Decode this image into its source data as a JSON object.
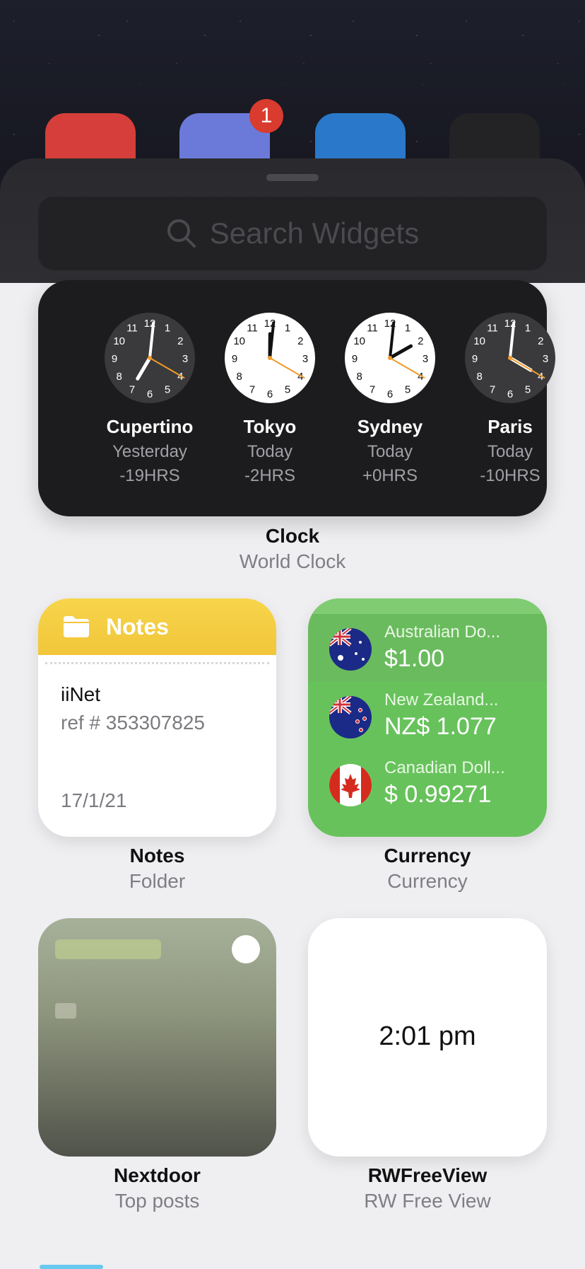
{
  "home": {
    "badge_count": "1"
  },
  "search": {
    "placeholder": "Search Widgets"
  },
  "clock_widget": {
    "cities": [
      {
        "name": "Cupertino",
        "day": "Yesterday",
        "offset": "-19HRS",
        "face": "dark",
        "hour": 7.0,
        "minute": 1
      },
      {
        "name": "Tokyo",
        "day": "Today",
        "offset": "-2HRS",
        "face": "light",
        "hour": 12.0,
        "minute": 1
      },
      {
        "name": "Sydney",
        "day": "Today",
        "offset": "+0HRS",
        "face": "light",
        "hour": 2.0,
        "minute": 1
      },
      {
        "name": "Paris",
        "day": "Today",
        "offset": "-10HRS",
        "face": "dark",
        "hour": 4.0,
        "minute": 1
      }
    ],
    "title": "Clock",
    "subtitle": "World Clock"
  },
  "notes_widget": {
    "header": "Notes",
    "note_title": "iiNet",
    "note_body": "ref # 353307825",
    "date": "17/1/21",
    "title": "Notes",
    "subtitle": "Folder"
  },
  "currency_widget": {
    "rows": [
      {
        "name": "Australian Do...",
        "value": "$1.00"
      },
      {
        "name": "New Zealand...",
        "value": "NZ$ 1.077"
      },
      {
        "name": "Canadian Doll...",
        "value": "$ 0.99271"
      }
    ],
    "title": "Currency",
    "subtitle": "Currency"
  },
  "nextdoor_widget": {
    "title": "Nextdoor",
    "subtitle": "Top posts"
  },
  "rwfreeview_widget": {
    "time": "2:01 pm",
    "title": "RWFreeView",
    "subtitle": "RW Free View"
  }
}
